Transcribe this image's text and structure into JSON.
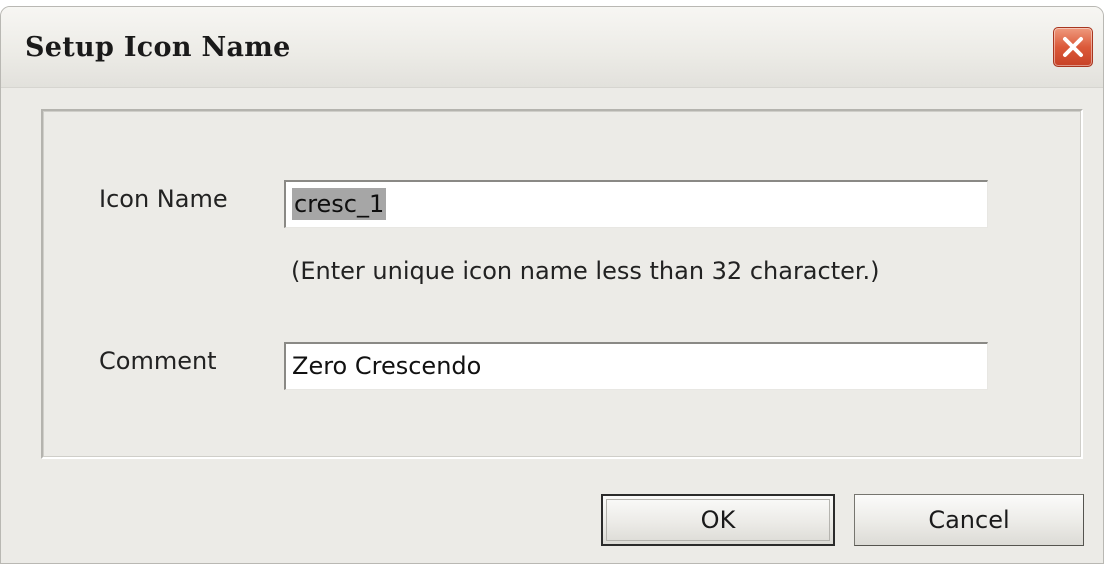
{
  "window": {
    "title": "Setup Icon Name"
  },
  "form": {
    "icon_name_label": "Icon Name",
    "icon_name_value": "cresc_1",
    "hint": "(Enter unique icon name less than 32 character.)",
    "comment_label": "Comment",
    "comment_value": "Zero Crescendo"
  },
  "buttons": {
    "ok": "OK",
    "cancel": "Cancel"
  },
  "icons": {
    "close": "close-icon"
  },
  "colors": {
    "close_button": "#dc5a3a",
    "selection": "#a6a6a6",
    "dialog_bg": "#ecebe7"
  }
}
